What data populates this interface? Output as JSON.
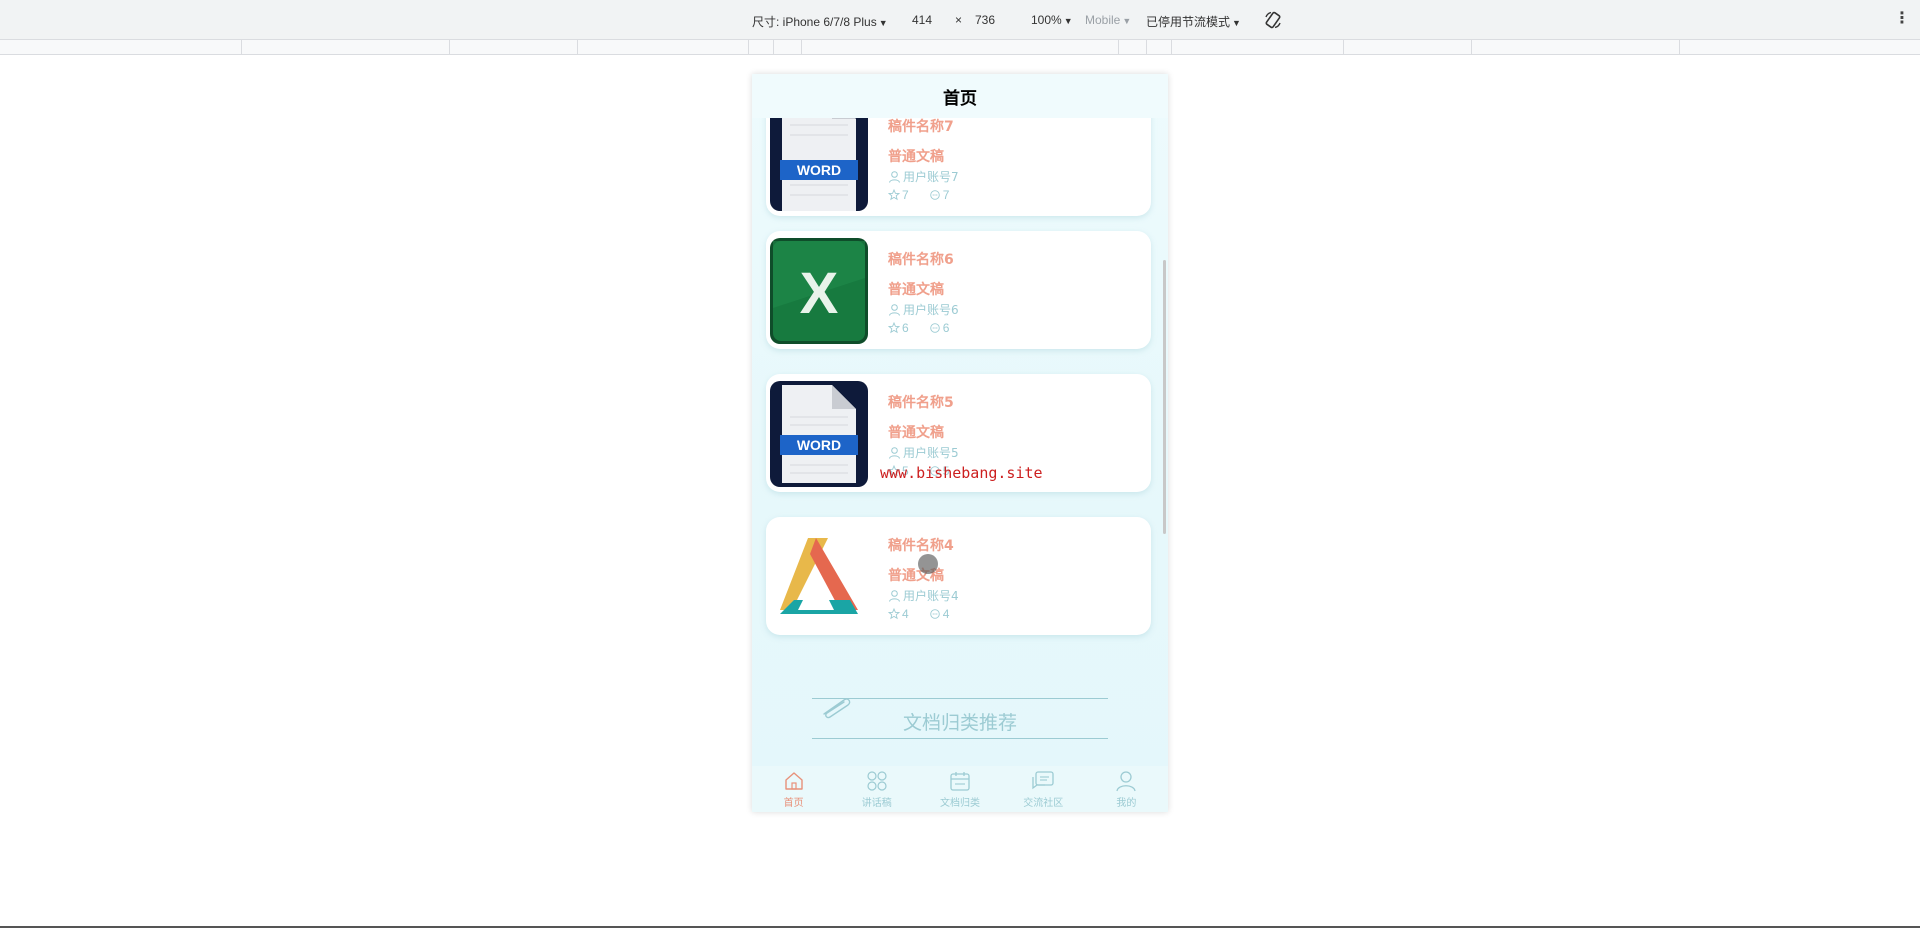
{
  "devtools": {
    "device_label": "尺寸: iPhone 6/7/8 Plus",
    "width": "414",
    "times": "×",
    "height": "736",
    "zoom": "100%",
    "mode": "Mobile",
    "throttle": "已停用节流模式",
    "menu_icon": "more-vert-icon",
    "rotate_icon": "rotate-icon"
  },
  "app": {
    "nav_title": "首页",
    "docs": [
      {
        "title": "稿件名称7",
        "type": "普通文稿",
        "user": "用户账号7",
        "stars": "7",
        "comments": "7",
        "thumb": "word"
      },
      {
        "title": "稿件名称6",
        "type": "普通文稿",
        "user": "用户账号6",
        "stars": "6",
        "comments": "6",
        "thumb": "excel"
      },
      {
        "title": "稿件名称5",
        "type": "普通文稿",
        "user": "用户账号5",
        "stars": "5",
        "comments": "5",
        "thumb": "word"
      },
      {
        "title": "稿件名称4",
        "type": "普通文稿",
        "user": "用户账号4",
        "stars": "4",
        "comments": "4",
        "thumb": "triangle"
      }
    ],
    "thumb_labels": {
      "word": "WORD",
      "excel": "X"
    },
    "section_title": "文档归类推荐",
    "tabs": [
      {
        "label": "首页",
        "icon": "home-icon",
        "active": true
      },
      {
        "label": "讲话稿",
        "icon": "grid-icon",
        "active": false
      },
      {
        "label": "文档归类",
        "icon": "calendar-icon",
        "active": false
      },
      {
        "label": "交流社区",
        "icon": "chat-icon",
        "active": false
      },
      {
        "label": "我的",
        "icon": "user-icon",
        "active": false
      }
    ]
  },
  "watermark": "www.bishebang.site",
  "colors": {
    "accent": "#f0a08c",
    "muted": "#9ccbd3",
    "active_tab": "#e8917a"
  }
}
